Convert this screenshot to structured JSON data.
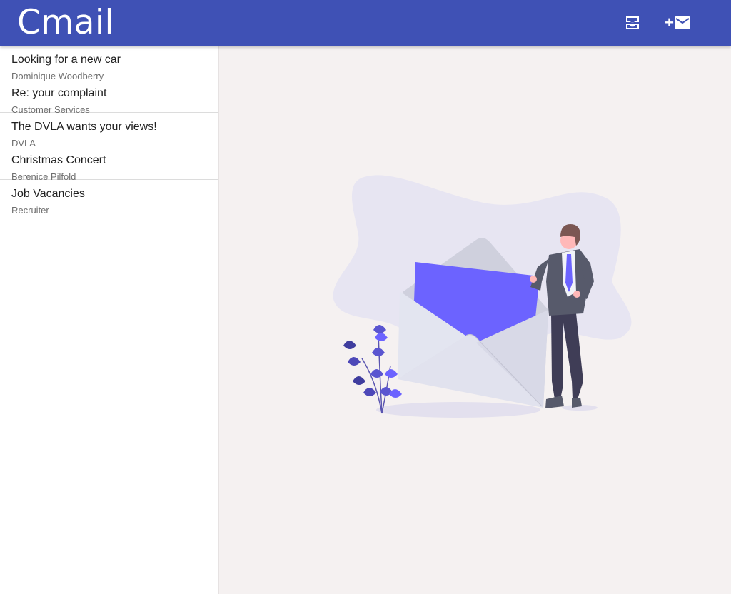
{
  "app": {
    "title": "Cmail"
  },
  "toolbar": {
    "inbox_icon": "all-inbox-icon",
    "compose_icon": "compose-mail-icon",
    "compose_plus": "+"
  },
  "colors": {
    "primary": "#3f51b5",
    "background": "#f5f1f1",
    "illustration_accent": "#6c63ff",
    "suit": "#575a6b",
    "blob": "#e7e5f2"
  },
  "emails": [
    {
      "subject": "Looking for a new car",
      "sender": "Dominique Woodberry"
    },
    {
      "subject": "Re: your complaint",
      "sender": "Customer Services"
    },
    {
      "subject": "The DVLA wants your views!",
      "sender": "DVLA"
    },
    {
      "subject": "Christmas Concert",
      "sender": "Berenice Pilfold"
    },
    {
      "subject": "Job Vacancies",
      "sender": "Recruiter"
    }
  ],
  "empty_state": {
    "illustration": "envelope-person-illustration"
  }
}
